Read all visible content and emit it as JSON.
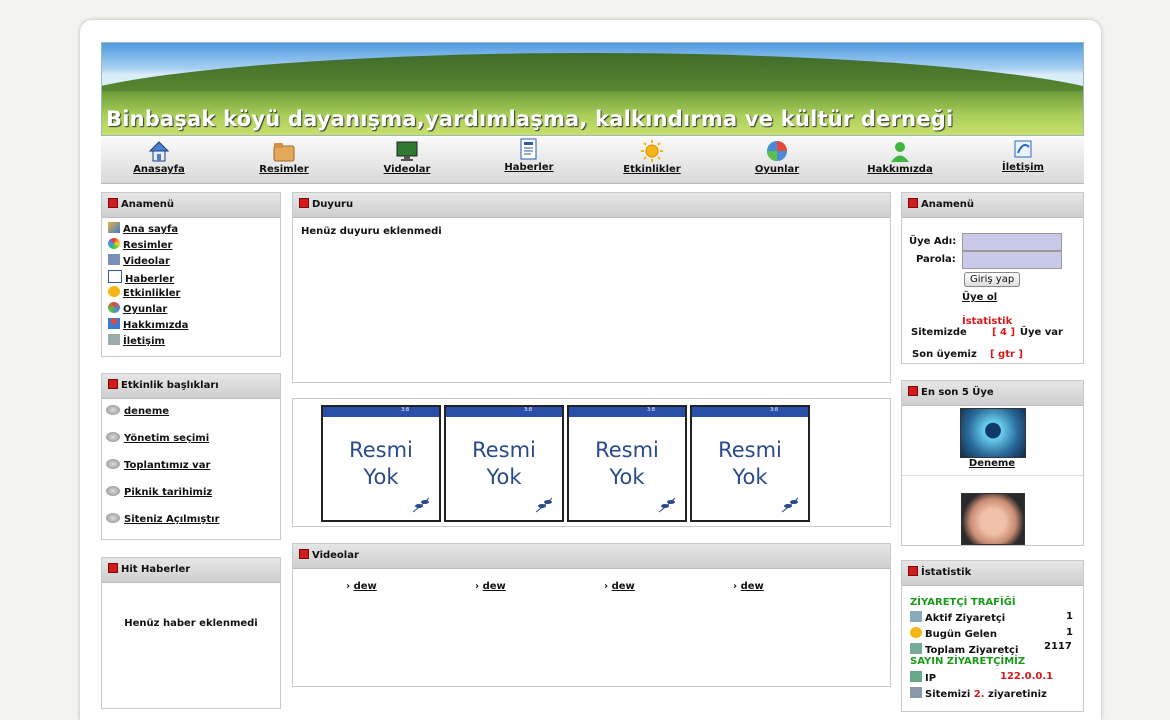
{
  "site": {
    "title": "Binbaşak köyü dayanışma,yardımlaşma, kalkındırma ve kültür derneği"
  },
  "nav": [
    {
      "label": "Anasayfa",
      "icon": "home-icon"
    },
    {
      "label": "Resimler",
      "icon": "folder-icon"
    },
    {
      "label": "Videolar",
      "icon": "monitor-icon"
    },
    {
      "label": "Haberler",
      "icon": "news-icon"
    },
    {
      "label": "Etkinlikler",
      "icon": "sun-icon"
    },
    {
      "label": "Oyunlar",
      "icon": "ball-icon"
    },
    {
      "label": "Hakkımızda",
      "icon": "person-icon"
    },
    {
      "label": "İletişim",
      "icon": "contact-icon"
    }
  ],
  "left_menu": {
    "title": "Anamenü",
    "items": [
      "Ana sayfa",
      "Resimler",
      "Videolar",
      "Haberler",
      "Etkinlikler",
      "Oyunlar",
      "Hakkımızda",
      "İletişim"
    ]
  },
  "activities": {
    "title": "Etkinlik başlıkları",
    "items": [
      "deneme",
      "Yönetim seçimi",
      "Toplantımız var",
      "Piknik tarihimiz",
      "Siteniz Açılmıştır"
    ]
  },
  "hit_news": {
    "title": "Hit Haberler",
    "empty": "Henüz haber eklenmedi"
  },
  "announcement": {
    "title": "Duyuru",
    "empty": "Henüz duyuru eklenmedi"
  },
  "gallery": {
    "placeholder_line1": "Resmi",
    "placeholder_line2": "Yok",
    "count": 4
  },
  "videos": {
    "title": "Videolar",
    "items": [
      "dew",
      "dew",
      "dew",
      "dew"
    ]
  },
  "login": {
    "title": "Anamenü",
    "user_label": "Üye Adı:",
    "pass_label": "Parola:",
    "button": "Giriş yap",
    "register": "Üye ol",
    "stats_heading": "İstatistik",
    "members_prefix": "Sitemizde",
    "members_count": "[ 4 ]",
    "members_suffix": "Üye var",
    "last_member_label": "Son üyemiz",
    "last_member": "[ gtr ]"
  },
  "latest_members": {
    "title": "En son 5 Üye",
    "first_name": "Deneme"
  },
  "statistics": {
    "title": "İstatistik",
    "traffic_heading": "ZİYARETÇİ TRAFİĞİ",
    "active_label": "Aktif Ziyaretçi",
    "active_value": "1",
    "today_label": "Bugün Gelen",
    "today_value": "1",
    "total_label": "Toplam Ziyaretçi",
    "total_value": "2117",
    "visitor_heading": "SAYIN ZİYARETÇİMİZ",
    "ip_label": "IP",
    "ip_value": "122.0.0.1",
    "visit_prefix": "Sitemizi",
    "visit_count": "2.",
    "visit_suffix": "ziyaretiniz"
  }
}
